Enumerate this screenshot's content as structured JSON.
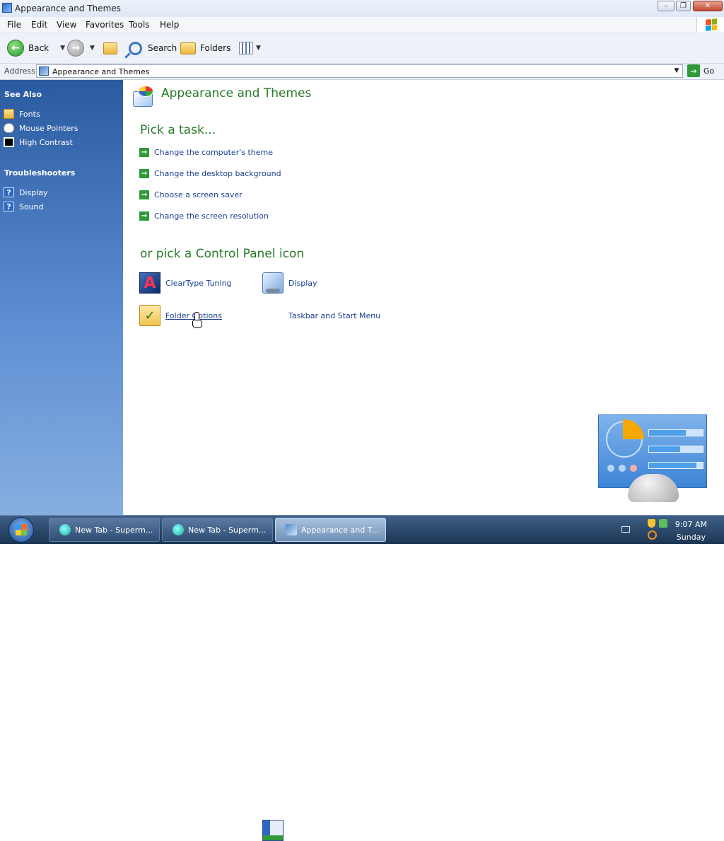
{
  "window": {
    "title": "Appearance and Themes",
    "controls": [
      "minimize",
      "restore",
      "close"
    ]
  },
  "menubar": {
    "items": [
      "File",
      "Edit",
      "View",
      "Favorites",
      "Tools",
      "Help"
    ]
  },
  "toolbar": {
    "back_label": "Back",
    "search_label": "Search",
    "folders_label": "Folders"
  },
  "address": {
    "label": "Address",
    "value": "Appearance and Themes",
    "go_label": "Go"
  },
  "sidebar": {
    "see_also": {
      "heading": "See Also",
      "items": [
        {
          "label": "Fonts",
          "icon": "fonts-folder-icon"
        },
        {
          "label": "Mouse Pointers",
          "icon": "mouse-icon"
        },
        {
          "label": "High Contrast",
          "icon": "high-contrast-icon"
        }
      ]
    },
    "troubleshooters": {
      "heading": "Troubleshooters",
      "items": [
        {
          "label": "Display",
          "icon": "help-icon"
        },
        {
          "label": "Sound",
          "icon": "help-icon"
        }
      ]
    }
  },
  "main": {
    "title": "Appearance and Themes",
    "tasks_heading": "Pick a task...",
    "tasks": [
      "Change the computer's theme",
      "Change the desktop background",
      "Choose a screen saver",
      "Change the screen resolution"
    ],
    "icons_heading": "or pick a Control Panel icon",
    "icons": [
      {
        "label": "ClearType Tuning",
        "icon": "cleartype-icon"
      },
      {
        "label": "Display",
        "icon": "display-icon"
      },
      {
        "label": "Folder Options",
        "icon": "folder-options-icon"
      },
      {
        "label": "Taskbar and Start Menu",
        "icon": "taskbar-start-menu-icon"
      }
    ]
  },
  "taskbar": {
    "buttons": [
      {
        "label": "New Tab - Superm...",
        "active": false
      },
      {
        "label": "New Tab - Superm...",
        "active": false
      },
      {
        "label": "Appearance and T...",
        "active": true
      }
    ],
    "clock": {
      "time": "9:07 AM",
      "day": "Sunday"
    }
  },
  "colors": {
    "heading_green": "#2a7a2a",
    "link_blue": "#1a3f8f",
    "sidebar_top": "#2a5aa0",
    "sidebar_bottom": "#87aee0",
    "arrow_green": "#2f9a39"
  }
}
